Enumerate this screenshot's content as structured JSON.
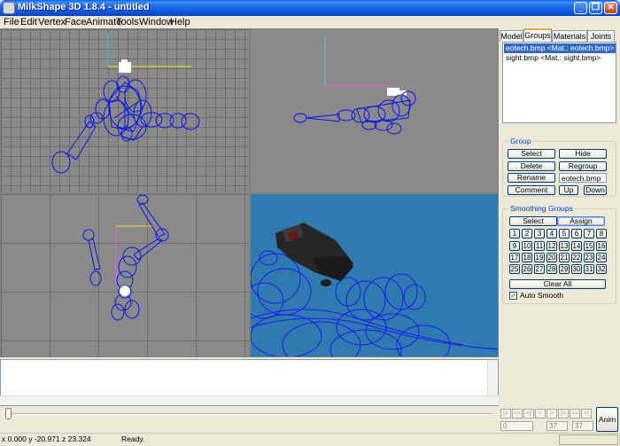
{
  "window": {
    "title": "MilkShape 3D 1.8.4 - untitled",
    "controls": {
      "minimize": "_",
      "maximize": "❐",
      "close": "✕"
    }
  },
  "menu": [
    "File",
    "Edit",
    "Vertex",
    "Face",
    "Animate",
    "Tools",
    "Window",
    "Help"
  ],
  "panel": {
    "tabs": [
      "Model",
      "Groups",
      "Materials",
      "Joints"
    ],
    "active_tab": "Groups",
    "groups_list": [
      "eotech.bmp <Mat.: eotech.bmp>",
      "sight.bmp <Mat.: sight.bmp>"
    ],
    "group_box": {
      "title": "Group",
      "select": "Select",
      "hide": "Hide",
      "delete": "Delete",
      "regroup": "Regroup",
      "rename": "Rename",
      "name_value": "eotech.bmp",
      "comment": "Comment",
      "up": "Up",
      "down": "Down"
    },
    "smoothing": {
      "title": "Smoothing Groups",
      "select": "Select",
      "assign": "Assign",
      "numbers": [
        "1",
        "2",
        "3",
        "4",
        "5",
        "6",
        "7",
        "8",
        "9",
        "10",
        "11",
        "12",
        "13",
        "14",
        "15",
        "16",
        "17",
        "18",
        "19",
        "20",
        "21",
        "22",
        "23",
        "24",
        "25",
        "26",
        "27",
        "28",
        "29",
        "30",
        "31",
        "32"
      ],
      "clear_all": "Clear All",
      "auto_smooth": "Auto Smooth",
      "auto_smooth_checked": true
    }
  },
  "animation": {
    "buttons": [
      "|<",
      "<<",
      "<|",
      "<",
      ">",
      "|>",
      ">>",
      ">|"
    ],
    "frame_start": "0",
    "frame_current": "37",
    "frame_end": "37",
    "anim_label": "Anim"
  },
  "status": {
    "coords": "x 0.000 y -20.971 z 23.324",
    "text": "Ready."
  }
}
